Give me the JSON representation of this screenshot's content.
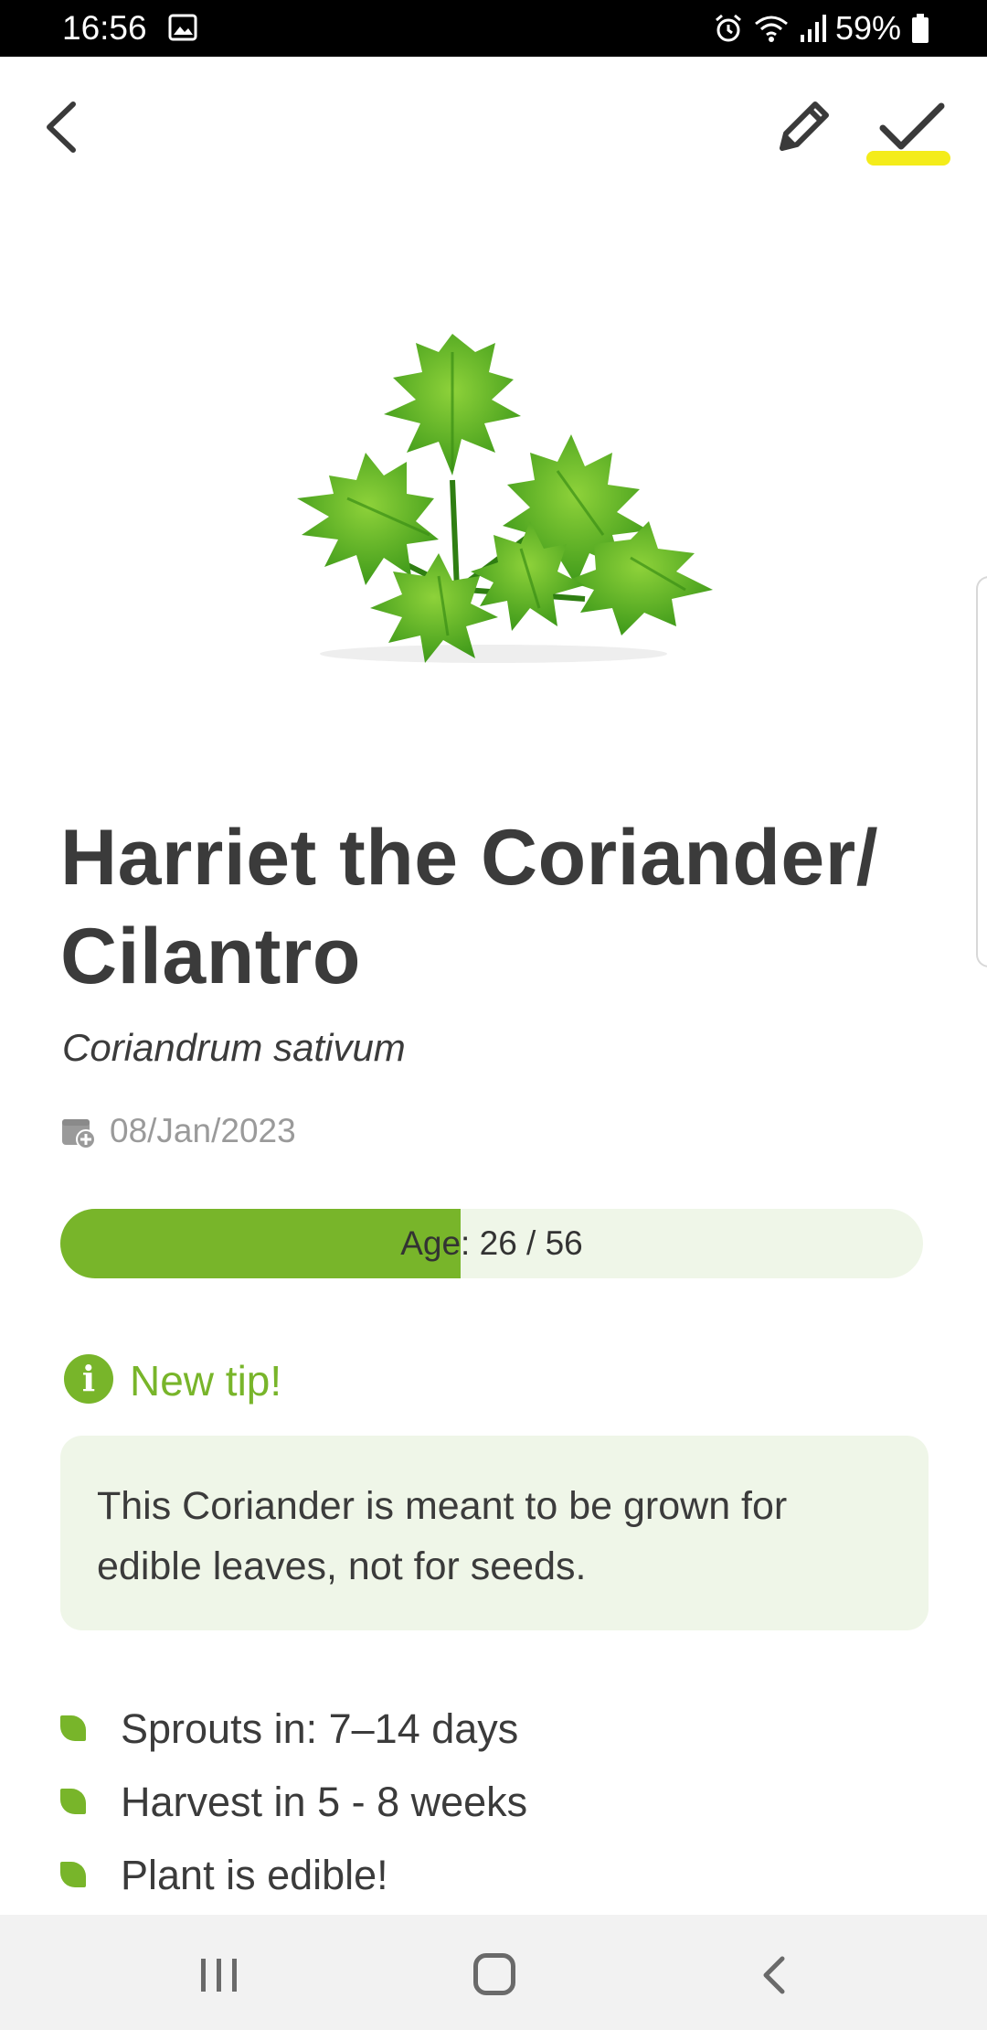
{
  "status_bar": {
    "time": "16:56",
    "battery": "59%",
    "icons": [
      "gallery-icon",
      "alarm-icon",
      "wifi-icon",
      "signal-icon",
      "battery-icon"
    ]
  },
  "app_bar": {
    "icons": [
      "back-arrow-icon",
      "pencil-icon",
      "checkmark-icon"
    ],
    "accent_color": "#f4ec1a"
  },
  "plant": {
    "image": "coriander-leaves-image",
    "name": "Harriet the Coriander/ Cilantro",
    "species": "Coriandrum sativum",
    "planted_date": "08/Jan/2023",
    "date_icon": "calendar-add-icon"
  },
  "age": {
    "label": "Age: 26 / 56",
    "current": 26,
    "total": 56,
    "fill_color": "#78b52a",
    "track_color": "#eff6e8"
  },
  "tip": {
    "icon": "info-icon",
    "heading": "New tip!",
    "text": "This Coriander is meant to be grown for edible leaves, not for seeds."
  },
  "facts": [
    {
      "text": "Sprouts in: 7–14 days",
      "icon": "leaf-icon"
    },
    {
      "text": "Harvest in 5 - 8 weeks",
      "icon": "leaf-icon"
    },
    {
      "text": "Plant is edible!",
      "icon": "leaf-icon"
    }
  ],
  "nav_bar": {
    "icons": [
      "recents-icon",
      "home-icon",
      "back-icon"
    ]
  },
  "colors": {
    "primary_green": "#78b52a",
    "text_dark": "#3b3b3b",
    "text_muted": "#9a9a9a"
  }
}
